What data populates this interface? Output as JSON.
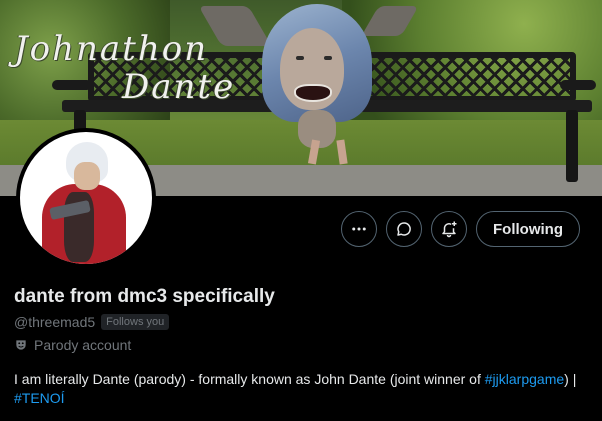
{
  "banner": {
    "title_line1": "Johnathon",
    "title_line2": "Dante"
  },
  "actions": {
    "more_icon": "more-horizontal-icon",
    "message_icon": "message-bubble-icon",
    "notify_icon": "bell-plus-icon",
    "follow_label": "Following"
  },
  "profile": {
    "name": "dante from dmc3 specifically",
    "handle": "@threemad5",
    "follows_you": "Follows you",
    "parody_label": "Parody account",
    "bio_text_1": "I am literally Dante (parody) - formally known as John Dante (joint winner of",
    "bio_link_1": "#jjklarpgame",
    "bio_text_2": ") | ",
    "bio_link_2": "#TENOÍ"
  },
  "colors": {
    "background": "#000000",
    "text": "#e7e9ea",
    "muted": "#71767b",
    "link": "#1d9bf0",
    "border": "#536471"
  }
}
